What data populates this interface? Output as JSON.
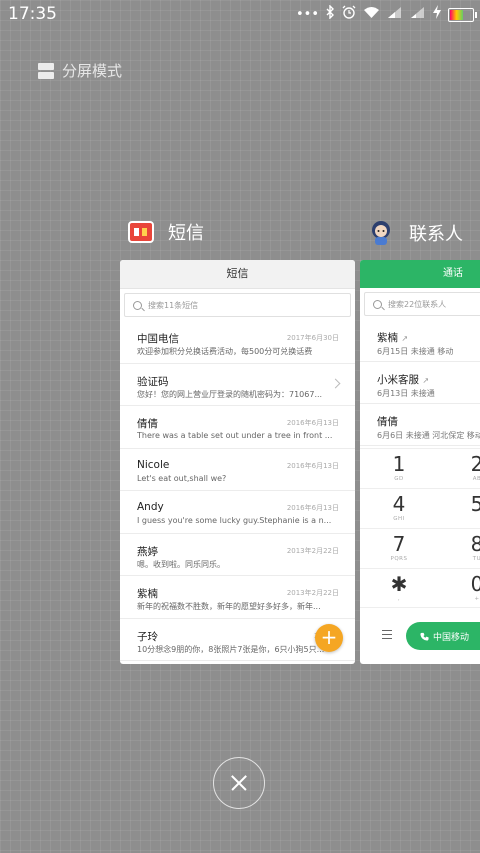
{
  "status": {
    "time": "17:35"
  },
  "split_mode": {
    "label": "分屏模式"
  },
  "apps": {
    "sms": {
      "label": "短信",
      "icon": "sms-app-icon"
    },
    "contacts": {
      "label": "联系人",
      "icon": "contacts-app-icon"
    }
  },
  "sms": {
    "title": "短信",
    "search_placeholder": "搜索11条短信",
    "messages": [
      {
        "name": "中国电信",
        "date": "2017年6月30日",
        "preview": "欢迎参加积分兑换话费活动，每500分可兑换话费"
      },
      {
        "name": "验证码",
        "date": "",
        "preview": "您好！您的网上营业厅登录的随机密码为：71067..."
      },
      {
        "name": "倩倩",
        "date": "2016年6月13日",
        "preview": "There was a table set out under a tree in front ..."
      },
      {
        "name": "Nicole",
        "date": "2016年6月13日",
        "preview": "Let's eat out,shall we?"
      },
      {
        "name": "Andy",
        "date": "2016年6月13日",
        "preview": "I guess you're some lucky guy.Stephanie is a n..."
      },
      {
        "name": "燕婷",
        "date": "2013年2月22日",
        "preview": "嗯。收到啦。同乐同乐。"
      },
      {
        "name": "紫楠",
        "date": "2013年2月22日",
        "preview": "新年的祝福数不胜数，新年的愿望好多好多，新年..."
      },
      {
        "name": "子玲",
        "date": "2013年",
        "preview": "10分想念9朋的你，8张照片7张是你，6只小狗5只..."
      }
    ]
  },
  "contacts": {
    "tab": "通话",
    "search_placeholder": "搜索22位联系人",
    "calls": [
      {
        "name": "紫楠",
        "detail": "6月15日 未接通 移动"
      },
      {
        "name": "小米客服",
        "detail": "6月13日 未接通"
      },
      {
        "name": "倩倩",
        "detail": "6月6日 未接通 河北保定 移动"
      }
    ],
    "keys": [
      {
        "num": "1",
        "letters": "GD"
      },
      {
        "num": "2",
        "letters": "AB"
      },
      {
        "num": "4",
        "letters": "GHI"
      },
      {
        "num": "5",
        "letters": ""
      },
      {
        "num": "7",
        "letters": "PQRS"
      },
      {
        "num": "8",
        "letters": "TU"
      },
      {
        "num": "✱",
        "letters": ","
      },
      {
        "num": "0",
        "letters": "+"
      }
    ],
    "call_button": "中国移动"
  }
}
